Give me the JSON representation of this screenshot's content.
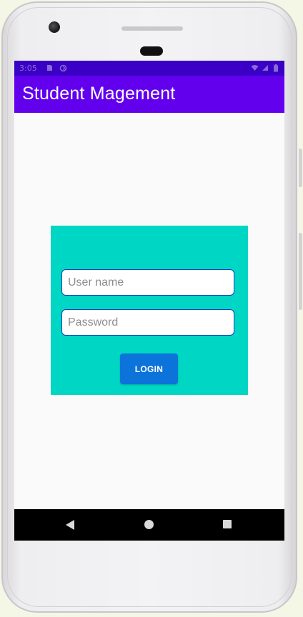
{
  "status_bar": {
    "time": "3:05",
    "icons": [
      "sim-card-icon",
      "sync-icon",
      "wifi-icon",
      "cell-signal-icon",
      "battery-icon"
    ]
  },
  "app_bar": {
    "title": "Student Magement"
  },
  "login": {
    "username_placeholder": "User name",
    "password_placeholder": "Password",
    "button_label": "LOGIN"
  },
  "navigation": {
    "icons": [
      "back-icon",
      "home-icon",
      "recent-apps-icon"
    ]
  },
  "colors": {
    "status_bar": "#3a00c5",
    "app_bar": "#6200ee",
    "login_card": "#00d6c4",
    "login_button": "#0c73da",
    "navigation_bar": "#000000"
  }
}
